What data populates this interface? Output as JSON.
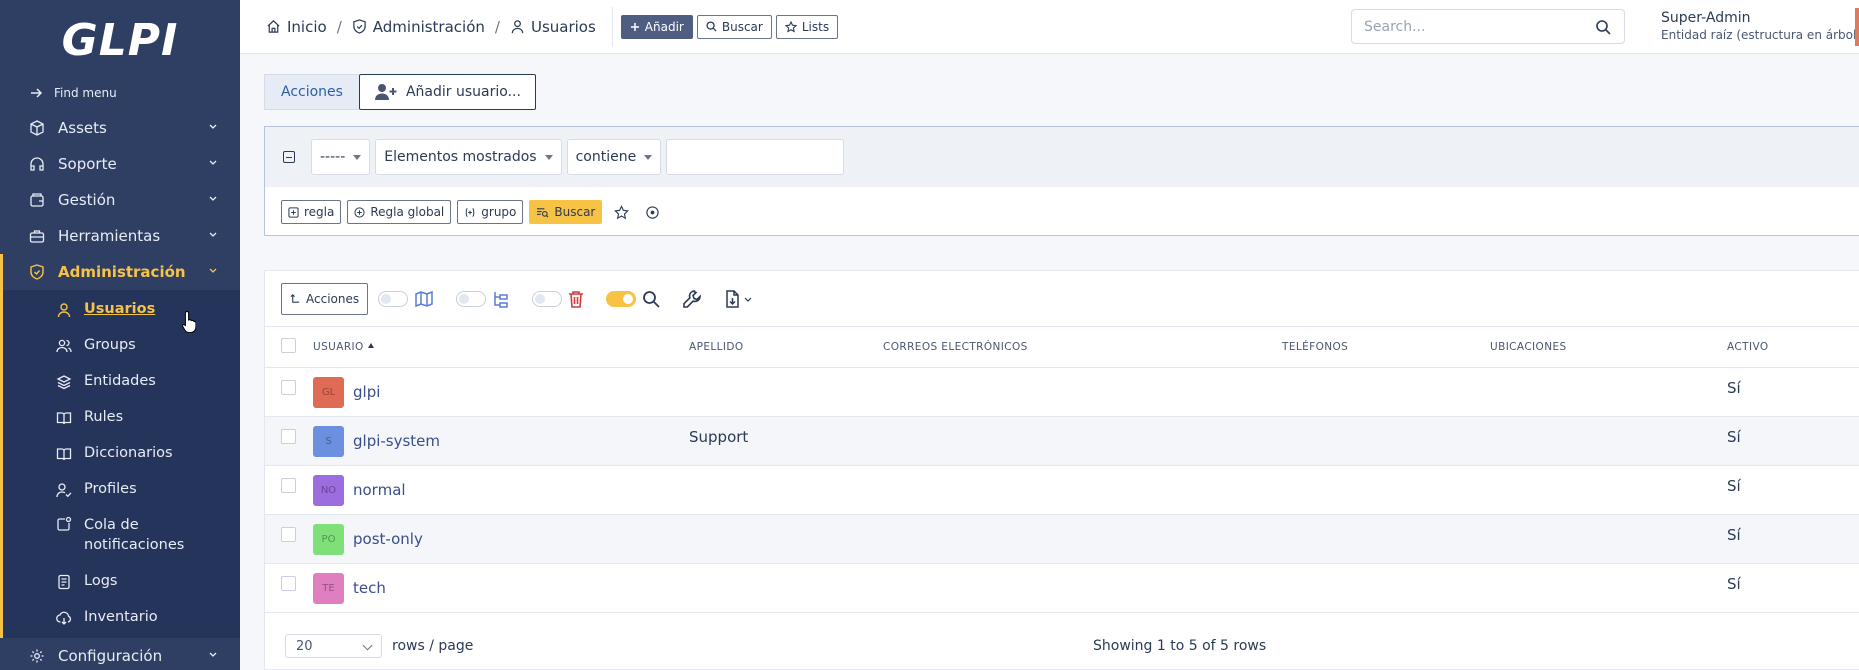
{
  "app": {
    "logo_text": "GLPI"
  },
  "sidebar": {
    "find_menu": "Find menu",
    "items": [
      {
        "label": "Assets",
        "icon": "cube-icon"
      },
      {
        "label": "Soporte",
        "icon": "headset-icon"
      },
      {
        "label": "Gestión",
        "icon": "wallet-icon"
      },
      {
        "label": "Herramientas",
        "icon": "briefcase-icon"
      },
      {
        "label": "Administración",
        "icon": "shield-icon"
      }
    ],
    "submenu": [
      {
        "label": "Usuarios",
        "icon": "user-icon"
      },
      {
        "label": "Groups",
        "icon": "users-icon"
      },
      {
        "label": "Entidades",
        "icon": "layers-icon"
      },
      {
        "label": "Rules",
        "icon": "book-icon"
      },
      {
        "label": "Diccionarios",
        "icon": "book-icon"
      },
      {
        "label": "Profiles",
        "icon": "user-check-icon"
      },
      {
        "label": "Cola de notificaciones",
        "icon": "notification-icon"
      },
      {
        "label": "Logs",
        "icon": "log-icon"
      },
      {
        "label": "Inventario",
        "icon": "cloud-download-icon"
      }
    ],
    "config": {
      "label": "Configuración",
      "icon": "gear-icon"
    }
  },
  "header": {
    "breadcrumb": [
      "Inicio",
      "Administración",
      "Usuarios"
    ],
    "add_label": "Añadir",
    "search_label": "Buscar",
    "lists_label": "Lists",
    "search_placeholder": "Search...",
    "user_name": "Super-Admin",
    "entity": "Entidad raíz (estructura en árbol)"
  },
  "tabs": {
    "actions": "Acciones",
    "add_user": "Añadir usuario..."
  },
  "criteria": {
    "link_op": "-----",
    "field": "Elementos mostrados",
    "operator": "contiene",
    "value": "",
    "rule_label": "regla",
    "global_rule_label": "Regla global",
    "group_label": "grupo",
    "search_label": "Buscar"
  },
  "toolbar": {
    "actions_label": "Acciones"
  },
  "table": {
    "columns": [
      "USUARIO",
      "APELLIDO",
      "CORREOS ELECTRÓNICOS",
      "TELÉFONOS",
      "UBICACIONES",
      "ACTIVO"
    ],
    "rows": [
      {
        "initials": "GL",
        "color": "#e06b55",
        "user": "glpi",
        "surname": "",
        "emails": "",
        "phones": "",
        "locations": "",
        "active": "Sí"
      },
      {
        "initials": "S",
        "color": "#6d8fe0",
        "user": "glpi-system",
        "surname": "Support",
        "emails": "",
        "phones": "",
        "locations": "",
        "active": "Sí"
      },
      {
        "initials": "NO",
        "color": "#9b6ddf",
        "user": "normal",
        "surname": "",
        "emails": "",
        "phones": "",
        "locations": "",
        "active": "Sí"
      },
      {
        "initials": "PO",
        "color": "#7fe07a",
        "user": "post-only",
        "surname": "",
        "emails": "",
        "phones": "",
        "locations": "",
        "active": "Sí"
      },
      {
        "initials": "TE",
        "color": "#e07fc0",
        "user": "tech",
        "surname": "",
        "emails": "",
        "phones": "",
        "locations": "",
        "active": "Sí"
      }
    ]
  },
  "footer": {
    "per_page": "20",
    "rows_page_label": "rows / page",
    "showing": "Showing 1 to 5 of 5 rows"
  },
  "colors": {
    "sidebar": "#2f3f64",
    "accent": "#f6c344",
    "primary": "#4f5d82"
  }
}
